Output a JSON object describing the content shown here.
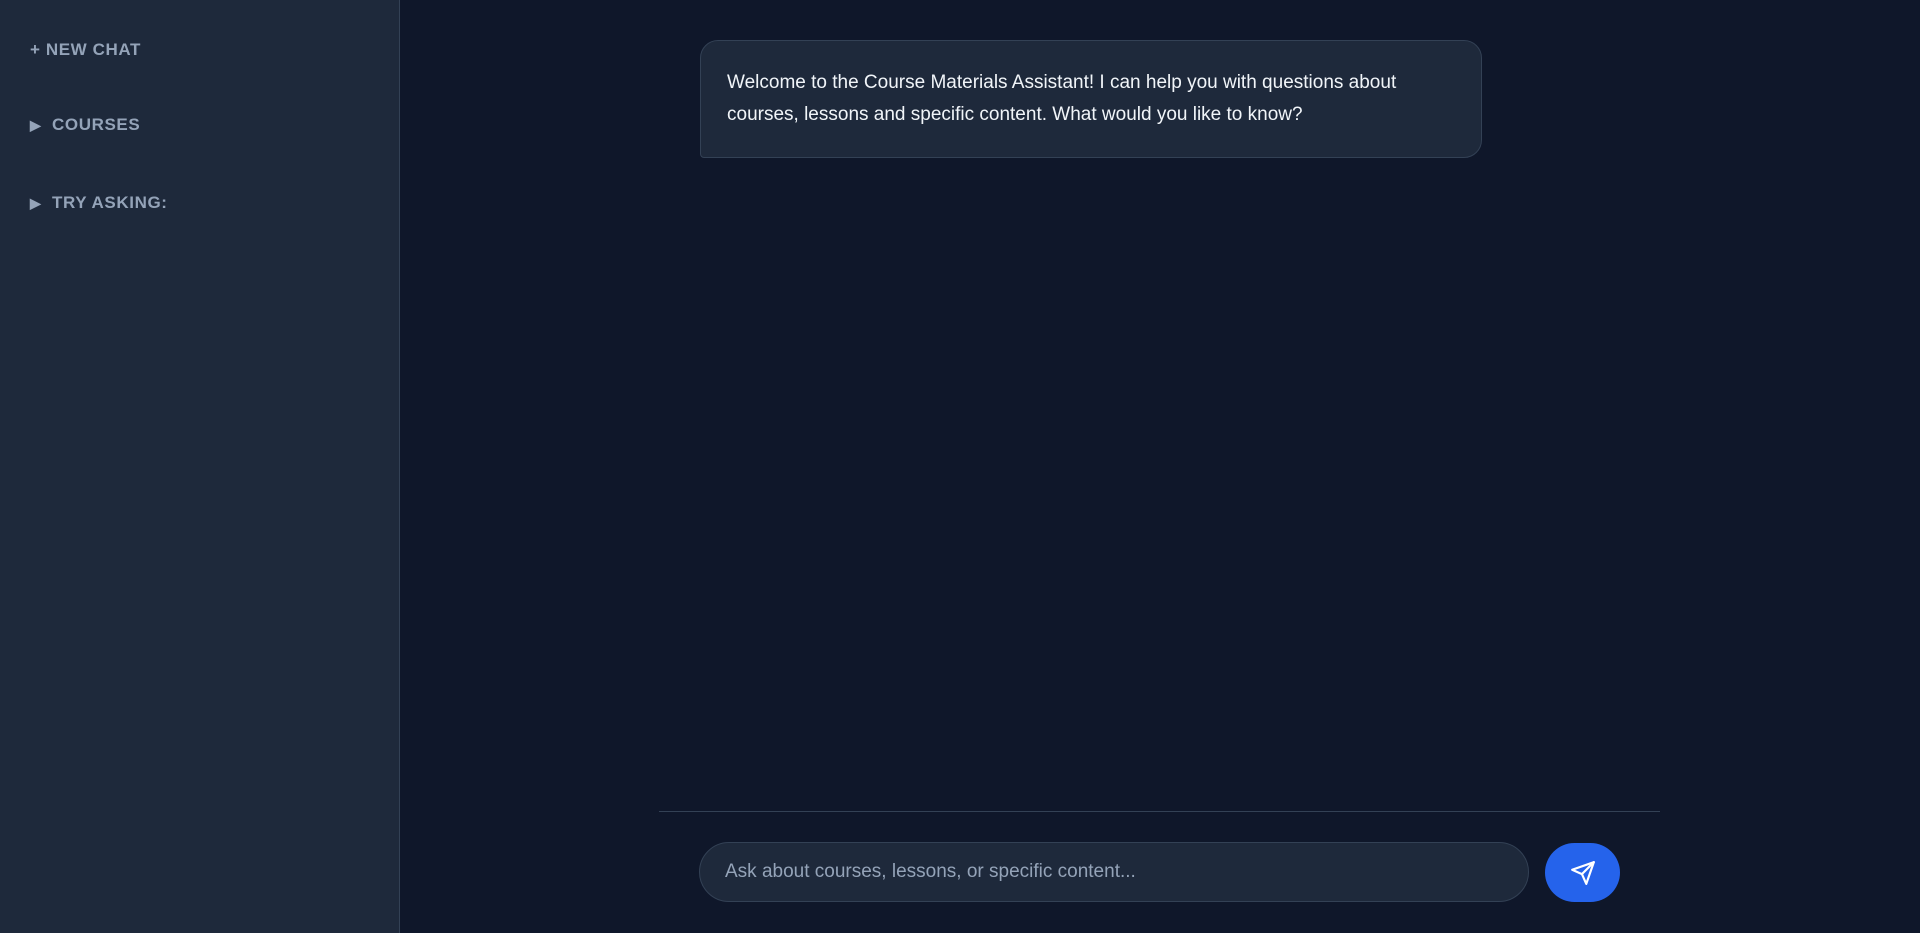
{
  "sidebar": {
    "new_chat_label": "+ NEW CHAT",
    "sections": [
      {
        "arrow": "▶",
        "label": "COURSES",
        "expanded": false
      },
      {
        "arrow": "▶",
        "label": "TRY ASKING:",
        "expanded": false
      }
    ]
  },
  "chat": {
    "messages": [
      {
        "role": "assistant",
        "text": "Welcome to the Course Materials Assistant! I can help you with questions about courses, lessons and specific content. What would you like to know?"
      }
    ]
  },
  "composer": {
    "placeholder": "Ask about courses, lessons, or specific content...",
    "value": "",
    "send_icon": "send-icon"
  },
  "colors": {
    "background": "#0f172a",
    "sidebar": "#1e293b",
    "border": "#334155",
    "muted_text": "#94a3b8",
    "text": "#f1f5f9",
    "accent": "#2563eb"
  }
}
